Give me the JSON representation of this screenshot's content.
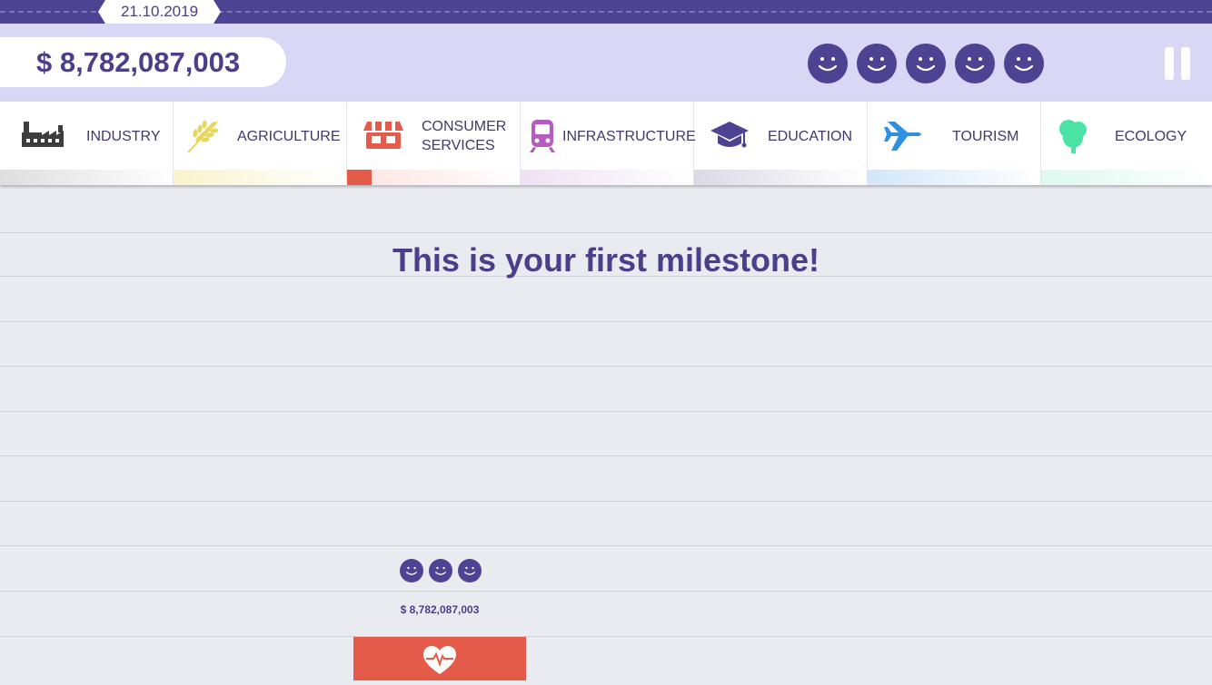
{
  "header": {
    "date": "21.10.2019",
    "money": "$ 8,782,087,003",
    "smiley_count": 5,
    "smiley_icon": "smiley-face-icon",
    "pause_icon": "pause-icon"
  },
  "categories": [
    {
      "id": "industry",
      "label": "INDUSTRY",
      "icon": "factory-icon",
      "icon_color": "#3d3d3d",
      "strip_color": "#dedede"
    },
    {
      "id": "agriculture",
      "label": "AGRICULTURE",
      "icon": "wheat-icon",
      "icon_color": "#e6d65a",
      "strip_color": "#f9f4cc"
    },
    {
      "id": "consumer-services",
      "label": "CONSUMER\nSERVICES",
      "icon": "storefront-icon",
      "icon_color": "#e55b4a",
      "strip_color": "#fde3e0",
      "progress": 0.14
    },
    {
      "id": "infrastructure",
      "label": "INFRASTRUCTURE",
      "icon": "train-icon",
      "icon_color": "#b45cc0",
      "strip_color": "#efe1f3"
    },
    {
      "id": "education",
      "label": "EDUCATION",
      "icon": "graduation-cap-icon",
      "icon_color": "#4d4392",
      "strip_color": "#dcd9e6"
    },
    {
      "id": "tourism",
      "label": "TOURISM",
      "icon": "airplane-icon",
      "icon_color": "#2f8fe0",
      "strip_color": "#d3e7fa"
    },
    {
      "id": "ecology",
      "label": "ECOLOGY",
      "icon": "tree-icon",
      "icon_color": "#4be3a5",
      "strip_color": "#ddf9ee"
    }
  ],
  "main": {
    "title": "This is your first milestone!",
    "milestone_smiley_count": 3,
    "milestone_money": "$ 8,782,087,003",
    "action_icon": "heart-pulse-icon"
  },
  "colors": {
    "primary": "#4d4392",
    "header_bg": "#d9d7f6",
    "board_bg": "#e9ebf0",
    "accent_red": "#e55b4a"
  }
}
